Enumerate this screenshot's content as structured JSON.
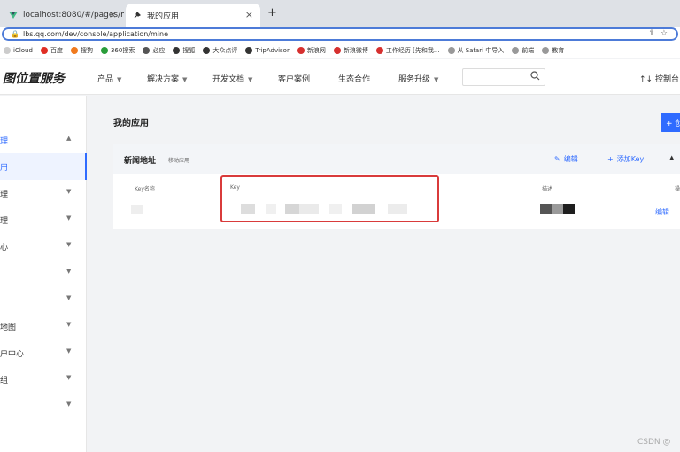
{
  "browser": {
    "tabs": [
      {
        "title": "localhost:8080/#/pages/map/",
        "active": false
      },
      {
        "title": "我的应用",
        "active": true
      }
    ],
    "new_tab_glyph": "+",
    "close_glyph": "×",
    "url": "lbs.qq.com/dev/console/application/mine",
    "bookmarks": [
      {
        "label": "iCloud",
        "icon": "apple-icon",
        "color": "#cccccc"
      },
      {
        "label": "百度",
        "icon": "baidu-icon",
        "color": "#e02e24"
      },
      {
        "label": "搜狗",
        "icon": "sogou-icon",
        "color": "#f07a1e"
      },
      {
        "label": "360搜索",
        "icon": "360-icon",
        "color": "#2a9d3a"
      },
      {
        "label": "必应",
        "icon": "bing-icon",
        "color": "#555555"
      },
      {
        "label": "搜狐",
        "icon": "sohu-icon",
        "color": "#333333"
      },
      {
        "label": "大众点评",
        "icon": "dianping-icon",
        "color": "#333333"
      },
      {
        "label": "TripAdvisor",
        "icon": "tripadvisor-icon",
        "color": "#333333"
      },
      {
        "label": "新浪网",
        "icon": "sina-icon",
        "color": "#d6302f"
      },
      {
        "label": "新浪微博",
        "icon": "weibo-icon",
        "color": "#d6302f"
      },
      {
        "label": "工作经历 [先和我...",
        "icon": "page-icon",
        "color": "#d6302f"
      },
      {
        "label": "从 Safari 中导入",
        "icon": "folder-icon",
        "color": "#999999"
      },
      {
        "label": "前端",
        "icon": "folder-icon",
        "color": "#999999"
      },
      {
        "label": "教育",
        "icon": "folder-icon",
        "color": "#999999"
      }
    ]
  },
  "header": {
    "brand": "图位置服务",
    "nav": [
      "产品",
      "解决方案",
      "开发文档",
      "客户案例",
      "生态合作",
      "服务升级"
    ],
    "nav_has_chevron": [
      true,
      true,
      true,
      false,
      false,
      true
    ],
    "console": "控制台"
  },
  "sidebar": {
    "items": [
      {
        "label": "理",
        "chevron": "▲",
        "state": "group"
      },
      {
        "label": "用",
        "chevron": "",
        "state": "active"
      },
      {
        "label": "理",
        "chevron": "▼",
        "state": ""
      },
      {
        "label": "理",
        "chevron": "▼",
        "state": ""
      },
      {
        "label": "心",
        "chevron": "▼",
        "state": ""
      },
      {
        "label": "",
        "chevron": "▼",
        "state": ""
      },
      {
        "label": "",
        "chevron": "▼",
        "state": ""
      },
      {
        "label": "地图",
        "chevron": "▼",
        "state": ""
      },
      {
        "label": "户中心",
        "chevron": "▼",
        "state": ""
      },
      {
        "label": "组",
        "chevron": "▼",
        "state": ""
      },
      {
        "label": "",
        "chevron": "▼",
        "state": ""
      }
    ]
  },
  "main": {
    "title": "我的应用",
    "create_label": "+ 创",
    "app": {
      "name": "新闻地址",
      "tag": "移动应用",
      "edit_label": "编辑",
      "add_key_label": "添加Key",
      "collapse_glyph": "▲"
    },
    "table": {
      "headers": [
        "Key名称",
        "Key",
        "描述",
        "操"
      ],
      "row_action": "编辑"
    }
  },
  "colors": {
    "accent": "#2f6bff",
    "highlight": "#d93b3b"
  },
  "watermark": "CSDN @"
}
